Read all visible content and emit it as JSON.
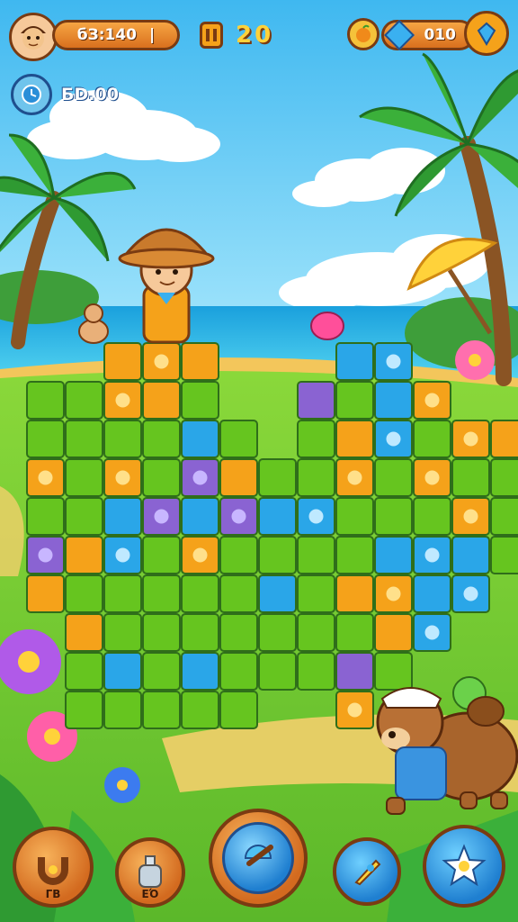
{
  "hud": {
    "score_text": "бЗ:140",
    "moves_text": "20",
    "timer_text": "БD.00",
    "gems_text": "010"
  },
  "bottom_bar": {
    "btn1_count": "ΓΒ",
    "btn2_count": "ΕΌ"
  },
  "colors": {
    "sky": "#4fc2f2",
    "sea": "#1fa9e0",
    "grass": "#6cc92e",
    "tile_green": "#66c51f",
    "tile_orange": "#f5a21a",
    "tile_blue": "#2aa6e8",
    "tile_purple": "#8a63d2",
    "hud_orange": "#e8862b",
    "hud_border": "#7a3b12"
  },
  "board": {
    "rows": [
      [
        "_",
        "_",
        "_",
        "_",
        "_",
        "_",
        "_",
        "_",
        "_",
        "_",
        "_",
        "_",
        "_"
      ],
      [
        "_",
        "_",
        "ro",
        "o",
        "o",
        "_",
        "_",
        "_",
        "b",
        "b",
        "_",
        "_",
        "_"
      ],
      [
        "g",
        "g",
        "yo",
        "o",
        "g",
        "_",
        "_",
        "p",
        "g",
        "b",
        "o",
        "_",
        "_"
      ],
      [
        "g",
        "g",
        "g",
        "g",
        "b",
        "g",
        "_",
        "g",
        "o",
        "b",
        "g",
        "o",
        "o"
      ],
      [
        "o",
        "g",
        "o",
        "g",
        "p",
        "o",
        "g",
        "g",
        "o",
        "g",
        "o",
        "g",
        "g"
      ],
      [
        "g",
        "g",
        "b",
        "p",
        "b",
        "p",
        "b",
        "b",
        "g",
        "g",
        "g",
        "o",
        "g"
      ],
      [
        "p",
        "o",
        "b",
        "g",
        "o",
        "g",
        "g",
        "g",
        "g",
        "b",
        "b",
        "b",
        "g"
      ],
      [
        "o",
        "g",
        "g",
        "g",
        "g",
        "g",
        "b",
        "g",
        "o",
        "o",
        "b",
        "b",
        "_"
      ],
      [
        "_",
        "o",
        "g",
        "g",
        "g",
        "g",
        "g",
        "g",
        "g",
        "o",
        "b",
        "_",
        "_"
      ],
      [
        "_",
        "g",
        "b",
        "g",
        "b",
        "g",
        "g",
        "g",
        "p",
        "g",
        "_",
        "_",
        "_"
      ],
      [
        "_",
        "g",
        "g",
        "g",
        "g",
        "g",
        "_",
        "_",
        "o",
        "_",
        "_",
        "_",
        "_"
      ]
    ]
  }
}
